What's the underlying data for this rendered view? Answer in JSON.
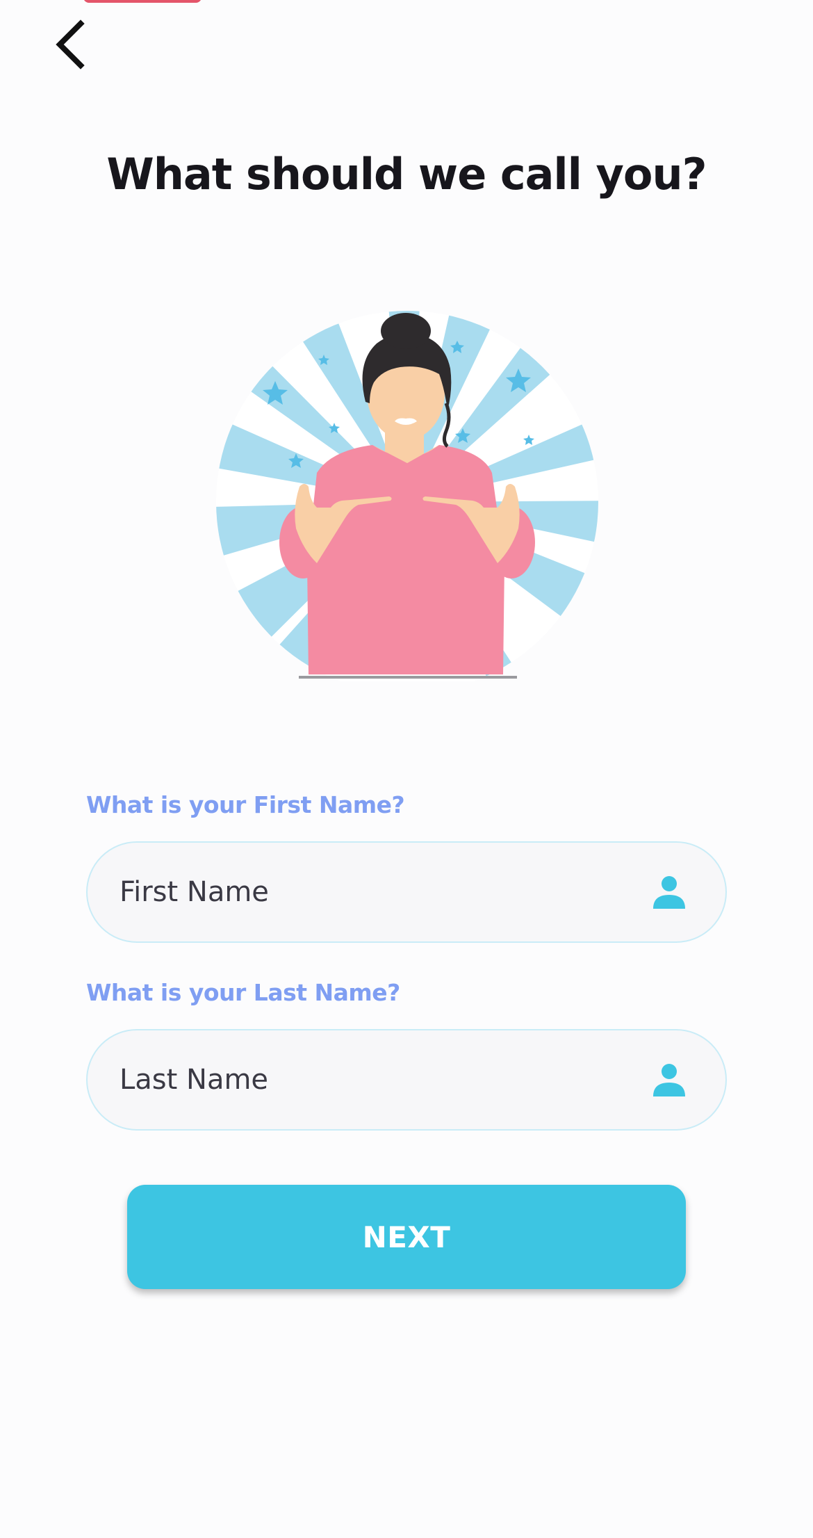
{
  "header": {
    "back_icon": "chevron-left-icon"
  },
  "page": {
    "title": "What should we call you?"
  },
  "form": {
    "first_name": {
      "label": "What is your First Name?",
      "placeholder": "First Name",
      "value": "",
      "icon": "user-icon"
    },
    "last_name": {
      "label": "What is your Last Name?",
      "placeholder": "Last Name",
      "value": "",
      "icon": "user-icon"
    },
    "submit_label": "NEXT"
  },
  "colors": {
    "accent": "#3dc5e2",
    "label": "#7f9ef2",
    "title": "#17161c",
    "field_border": "#c9ecf7",
    "field_bg": "#f7f7f9",
    "burst_blue": "#a9dcef",
    "shirt_pink": "#f48ba2",
    "skin": "#f9cfa6",
    "hair": "#2e2b2d"
  }
}
